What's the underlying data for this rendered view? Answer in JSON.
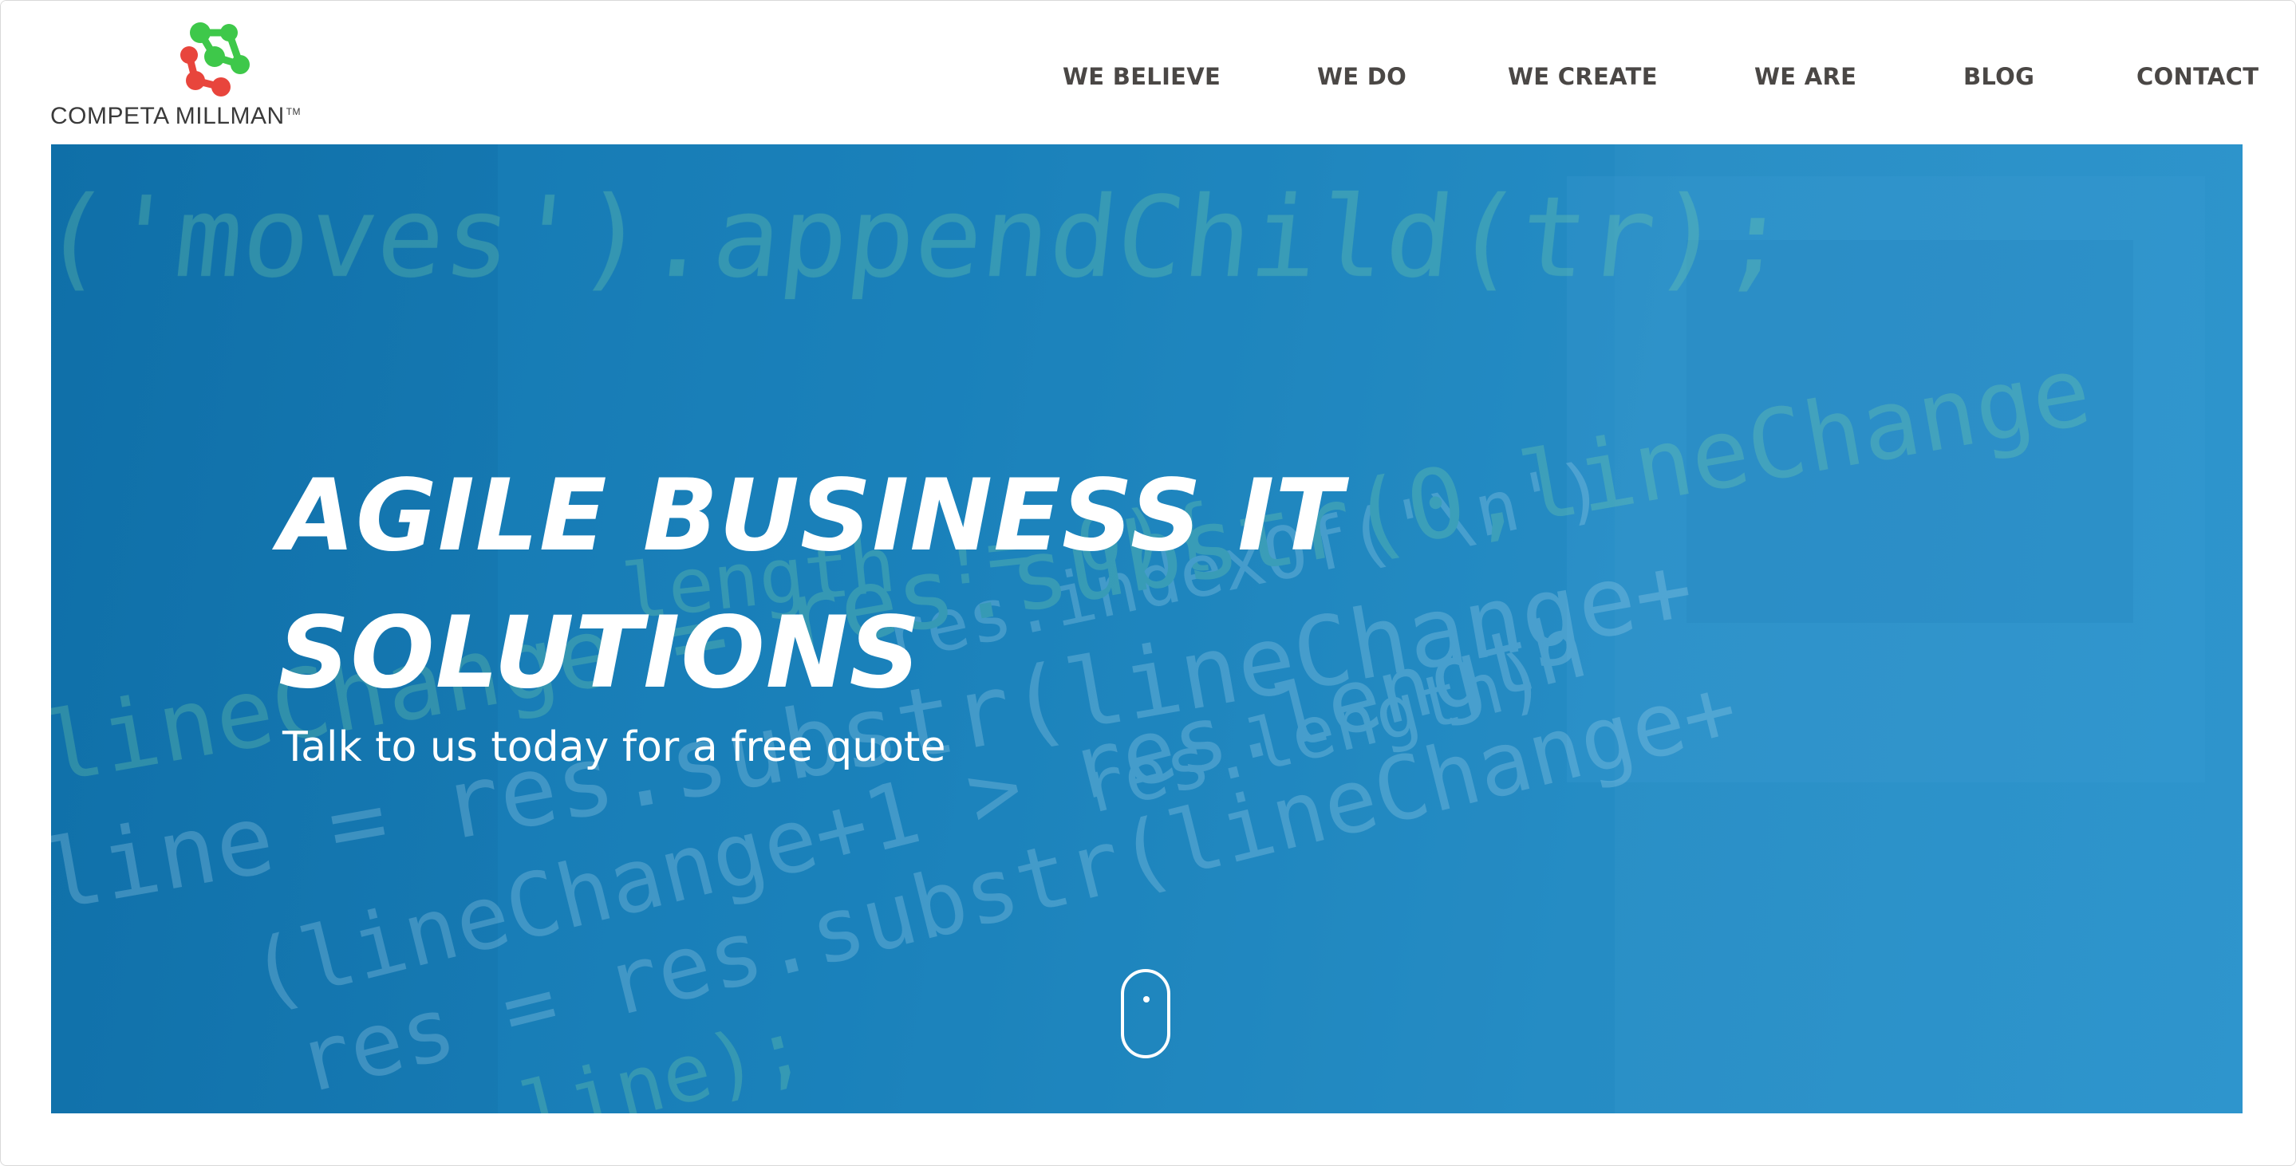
{
  "brand": {
    "name": "COMPETA MILLMAN",
    "trademark": "TM",
    "logo_colors": [
      "#3ec84a",
      "#e8453c"
    ]
  },
  "nav": {
    "items": [
      {
        "label": "WE BELIEVE"
      },
      {
        "label": "WE DO"
      },
      {
        "label": "WE CREATE"
      },
      {
        "label": "WE ARE"
      },
      {
        "label": "BLOG"
      },
      {
        "label": "CONTACT"
      }
    ]
  },
  "hero": {
    "title_line1": "AGILE BUSINESS IT",
    "title_line2": "SOLUTIONS",
    "subtitle": "Talk to us today for a free quote",
    "background_code": [
      "('moves').appendChild(tr);",
      "length != 0){",
      "res.indexOf('\\n')",
      "lineChange = res.substr(0,lineChange",
      "res.length)",
      "line = res.substr(lineChange+",
      "(lineChange+1 > res.length",
      "res = res.substr(lineChange+",
      "line);"
    ],
    "scroll_icon": "mouse-scroll-icon",
    "overlay_color": "#1a7fb8"
  }
}
